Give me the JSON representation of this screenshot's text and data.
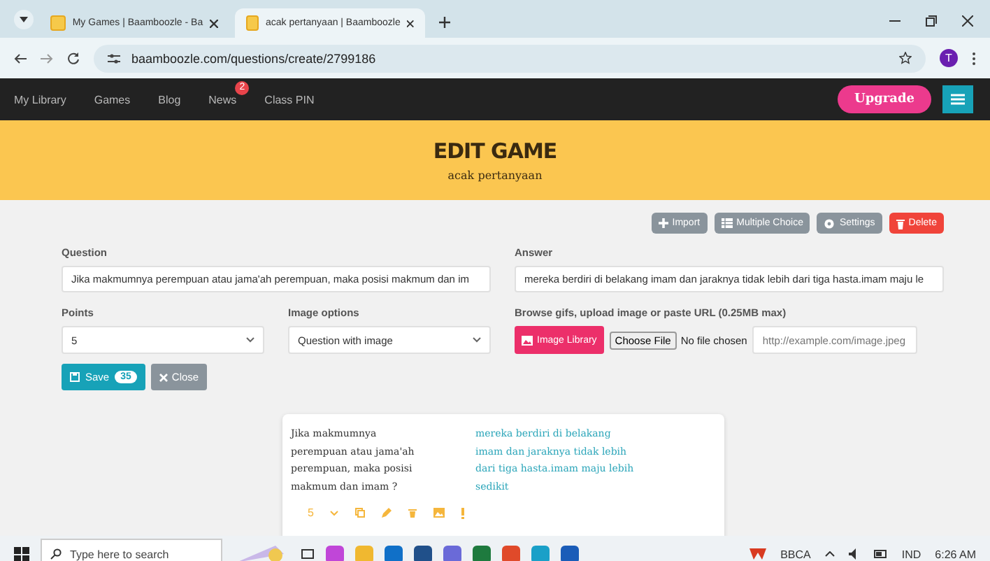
{
  "browser": {
    "tabs": [
      {
        "title": "My Games | Baamboozle - Ba",
        "selected": false
      },
      {
        "title": "acak pertanyaan | Baamboozle",
        "selected": true
      }
    ],
    "url": "baamboozle.com/questions/create/2799186",
    "profile": "T"
  },
  "nav": {
    "items": [
      {
        "label": "My Library"
      },
      {
        "label": "Games"
      },
      {
        "label": "Blog"
      },
      {
        "label": "News",
        "badge": "2"
      },
      {
        "label": "Class PIN"
      }
    ],
    "upgrade": "Upgrade"
  },
  "header": {
    "title": "EDIT GAME",
    "subtitle": "acak pertanyaan"
  },
  "toolbar": [
    {
      "label": "Import",
      "kind": "import"
    },
    {
      "label": "Multiple Choice",
      "kind": "list"
    },
    {
      "label": "Settings",
      "kind": "settings"
    },
    {
      "label": "Delete",
      "kind": "delete"
    }
  ],
  "form": {
    "question": {
      "label": "Question",
      "value": "Jika makmumnya perempuan atau jama'ah perempuan, maka posisi makmum dan im"
    },
    "answer": {
      "label": "Answer",
      "value": "mereka berdiri di belakang imam dan jaraknya tidak lebih dari tiga hasta.imam maju le"
    },
    "points": {
      "label": "Points",
      "value": "5"
    },
    "image_options": {
      "label": "Image options",
      "value": "Question with image"
    },
    "browse": {
      "label": "Browse gifs, upload image or paste URL (0.25MB max)",
      "library": "Image Library",
      "choose": "Choose File",
      "file_status": "No file chosen",
      "url_placeholder": "http://example.com/image.jpeg"
    },
    "save": "Save",
    "save_count": "35",
    "close": "Close"
  },
  "card": {
    "question": "Jika makmumnya perempuan atau jama'ah perempuan, maka posisi makmum dan imam ?",
    "answer": "mereka berdiri di belakang imam dan jaraknya tidak lebih dari tiga hasta.imam maju lebih sedikit",
    "points": "5"
  },
  "taskbar": {
    "search_placeholder": "Type here to search",
    "stock": "BBCA",
    "language": "IND",
    "time": "6:26 AM"
  }
}
